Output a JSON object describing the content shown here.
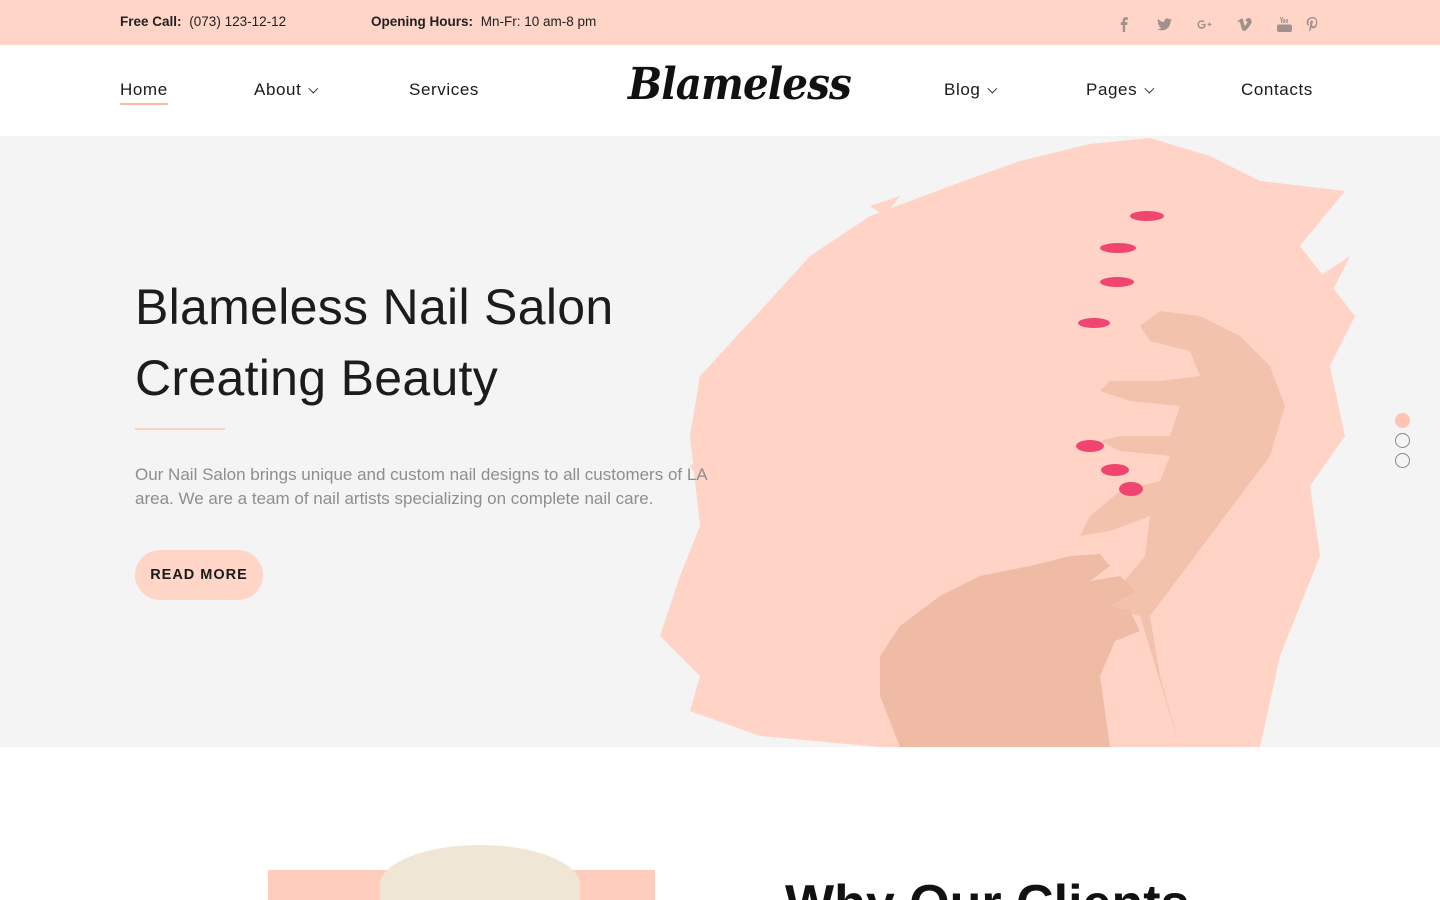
{
  "topbar": {
    "call_label": "Free Call:",
    "call_value": "(073) 123-12-12",
    "hours_label": "Opening Hours:",
    "hours_value": "Mn-Fr: 10 am-8 pm",
    "social": [
      "facebook-icon",
      "twitter-icon",
      "google-plus-icon",
      "vimeo-icon",
      "youtube-icon",
      "pinterest-icon"
    ]
  },
  "header": {
    "logo": "Blameless",
    "nav": {
      "home": "Home",
      "about": "About",
      "services": "Services",
      "blog": "Blog",
      "pages": "Pages",
      "contacts": "Contacts"
    }
  },
  "hero": {
    "title_line1": "Blameless Nail Salon",
    "title_line2": "Creating Beauty",
    "text": "Our Nail Salon brings unique and custom nail designs to all customers of LA area. We are a team of nail artists specializing on complete nail care.",
    "button": "READ MORE",
    "slides": 3,
    "active_slide": 1
  },
  "section2": {
    "title": "Why Our Clients"
  },
  "colors": {
    "accent": "#ffd5c8",
    "hero_bg": "#f4f4f4",
    "nail": "#f0456e"
  }
}
